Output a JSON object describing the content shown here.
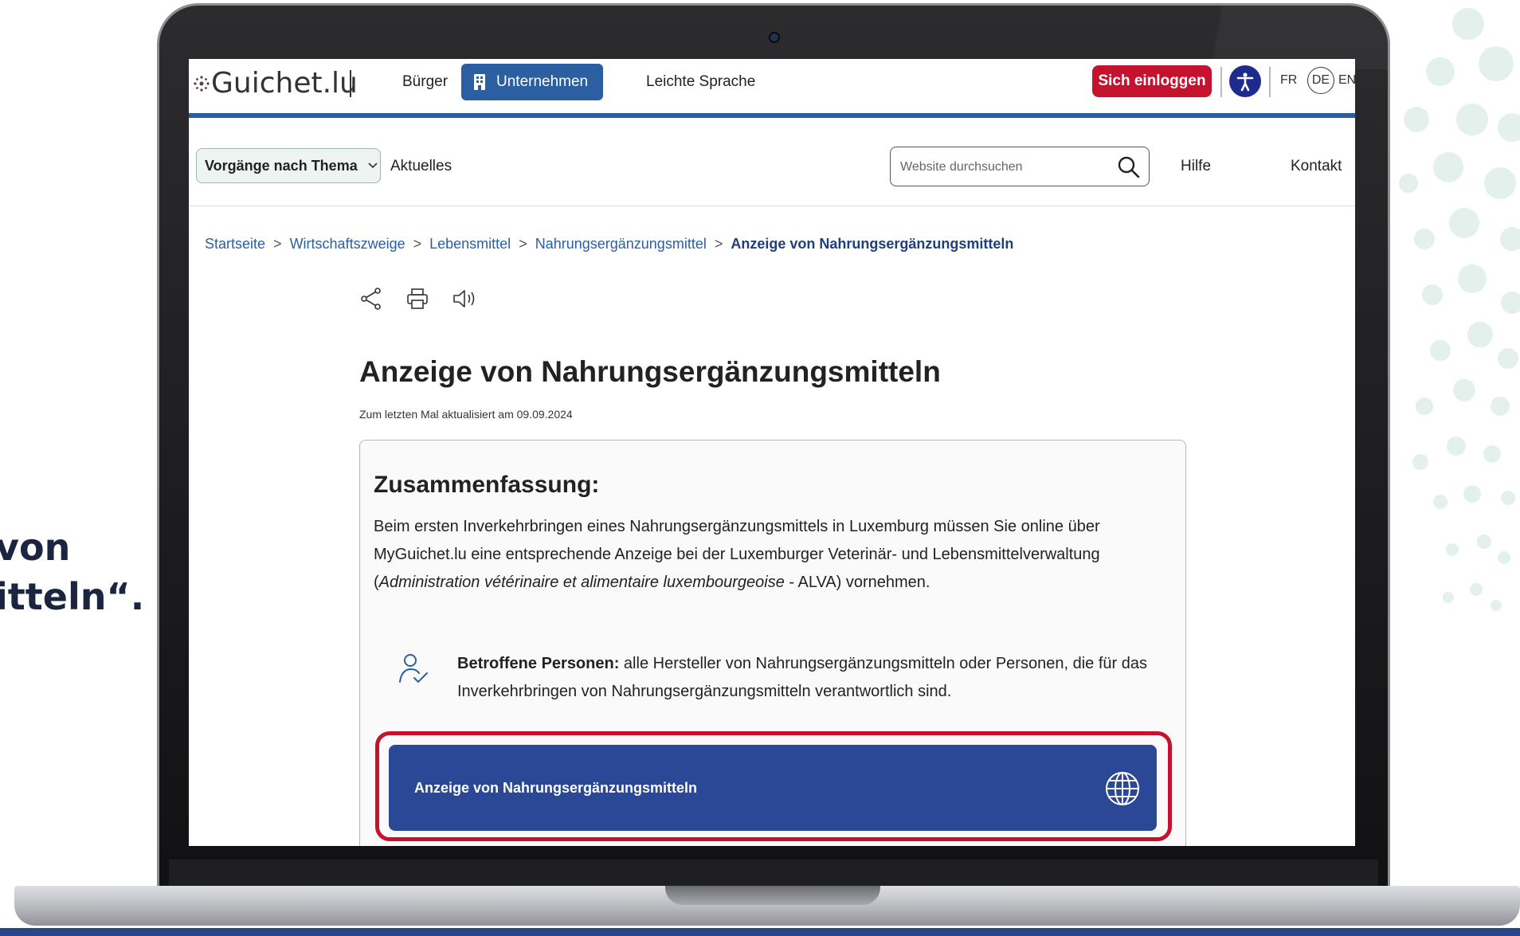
{
  "side_caption": {
    "line1": "von",
    "line2": "itteln“."
  },
  "header": {
    "logo": "Guichet.lu",
    "nav": {
      "buerger": "Bürger",
      "unternehmen": "Unternehmen",
      "leichte_sprache": "Leichte Sprache"
    },
    "login": "Sich einloggen",
    "languages": {
      "fr": "FR",
      "de": "DE",
      "en": "EN"
    }
  },
  "subnav": {
    "topics": "Vorgänge nach Thema",
    "aktuelles": "Aktuelles",
    "search_placeholder": "Website durchsuchen",
    "hilfe": "Hilfe",
    "kontakt": "Kontakt"
  },
  "breadcrumb": [
    "Startseite",
    "Wirtschaftszweige",
    "Lebensmittel",
    "Nahrungsergänzungsmittel",
    "Anzeige von Nahrungsergänzungsmitteln"
  ],
  "breadcrumb_separator": ">",
  "page": {
    "title": "Anzeige von Nahrungsergänzungsmitteln",
    "updated": "Zum letzten Mal aktualisiert am 09.09.2024"
  },
  "summary": {
    "heading": "Zusammenfassung:",
    "text_before": "Beim ersten Inverkehrbringen eines Nahrungsergänzungsmittels in Luxemburg müssen Sie online über MyGuichet.lu eine entsprechende Anzeige bei der Luxemburger Veterinär- und Lebensmittelverwaltung (",
    "text_italic": "Administration vétérinaire et alimentaire luxembourgeoise",
    "text_after": " - ALVA) vornehmen.",
    "persons_label": "Betroffene Personen:",
    "persons_text": " alle Hersteller von Nahrungsergänzungsmitteln oder Personen, die für das Inverkehrbringen von Nahrungsergänzungsmitteln verantwortlich sind.",
    "online_button": "Anzeige von Nahrungsergänzungsmitteln"
  },
  "colors": {
    "primary_blue": "#2c5ea2",
    "button_blue": "#2a4896",
    "login_red": "#c4122f",
    "highlight_red": "#c4122f",
    "a11y_navy": "#1d2b8c"
  }
}
